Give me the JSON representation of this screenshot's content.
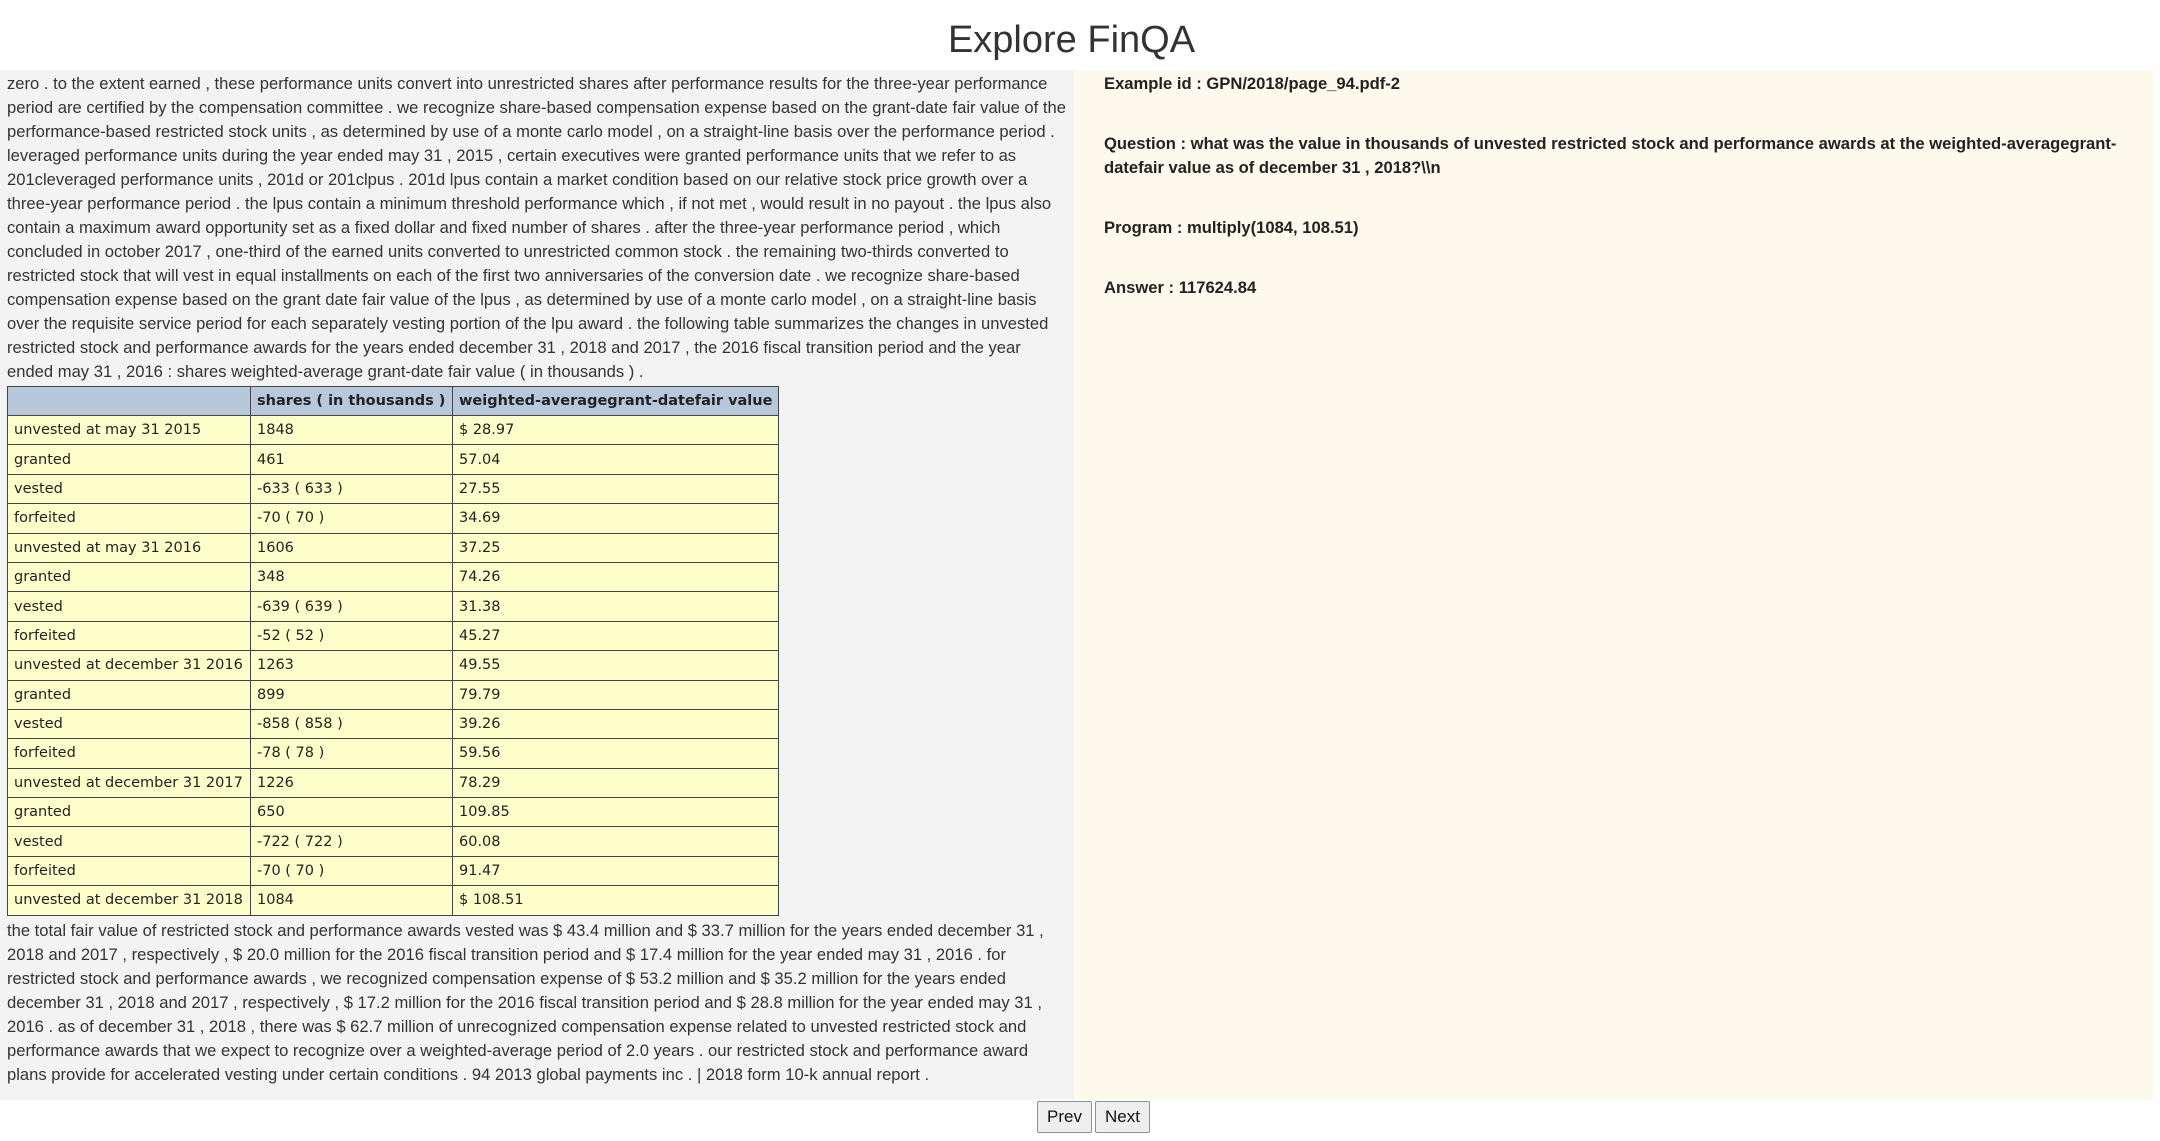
{
  "page": {
    "title": "Explore FinQA"
  },
  "context": {
    "pre_text": "zero . to the extent earned , these performance units convert into unrestricted shares after performance results for the three-year performance period are certified by the compensation committee . we recognize share-based compensation expense based on the grant-date fair value of the performance-based restricted stock units , as determined by use of a monte carlo model , on a straight-line basis over the performance period . leveraged performance units during the year ended may 31 , 2015 , certain executives were granted performance units that we refer to as 201cleveraged performance units , 201d or 201clpus . 201d lpus contain a market condition based on our relative stock price growth over a three-year performance period . the lpus contain a minimum threshold performance which , if not met , would result in no payout . the lpus also contain a maximum award opportunity set as a fixed dollar and fixed number of shares . after the three-year performance period , which concluded in october 2017 , one-third of the earned units converted to unrestricted common stock . the remaining two-thirds converted to restricted stock that will vest in equal installments on each of the first two anniversaries of the conversion date . we recognize share-based compensation expense based on the grant date fair value of the lpus , as determined by use of a monte carlo model , on a straight-line basis over the requisite service period for each separately vesting portion of the lpu award . the following table summarizes the changes in unvested restricted stock and performance awards for the years ended december 31 , 2018 and 2017 , the 2016 fiscal transition period and the year ended may 31 , 2016 : shares weighted-average grant-date fair value ( in thousands ) .",
    "post_text": "the total fair value of restricted stock and performance awards vested was $ 43.4 million and $ 33.7 million for the years ended december 31 , 2018 and 2017 , respectively , $ 20.0 million for the 2016 fiscal transition period and $ 17.4 million for the year ended may 31 , 2016 . for restricted stock and performance awards , we recognized compensation expense of $ 53.2 million and $ 35.2 million for the years ended december 31 , 2018 and 2017 , respectively , $ 17.2 million for the 2016 fiscal transition period and $ 28.8 million for the year ended may 31 , 2016 . as of december 31 , 2018 , there was $ 62.7 million of unrecognized compensation expense related to unvested restricted stock and performance awards that we expect to recognize over a weighted-average period of 2.0 years . our restricted stock and performance award plans provide for accelerated vesting under certain conditions . 94 2013 global payments inc . | 2018 form 10-k annual report ."
  },
  "table": {
    "headers": [
      "",
      "shares ( in thousands )",
      "weighted-averagegrant-datefair value"
    ],
    "rows": [
      [
        "unvested at may 31 2015",
        "1848",
        "$ 28.97"
      ],
      [
        "granted",
        "461",
        "57.04"
      ],
      [
        "vested",
        "-633 ( 633 )",
        "27.55"
      ],
      [
        "forfeited",
        "-70 ( 70 )",
        "34.69"
      ],
      [
        "unvested at may 31 2016",
        "1606",
        "37.25"
      ],
      [
        "granted",
        "348",
        "74.26"
      ],
      [
        "vested",
        "-639 ( 639 )",
        "31.38"
      ],
      [
        "forfeited",
        "-52 ( 52 )",
        "45.27"
      ],
      [
        "unvested at december 31 2016",
        "1263",
        "49.55"
      ],
      [
        "granted",
        "899",
        "79.79"
      ],
      [
        "vested",
        "-858 ( 858 )",
        "39.26"
      ],
      [
        "forfeited",
        "-78 ( 78 )",
        "59.56"
      ],
      [
        "unvested at december 31 2017",
        "1226",
        "78.29"
      ],
      [
        "granted",
        "650",
        "109.85"
      ],
      [
        "vested",
        "-722 ( 722 )",
        "60.08"
      ],
      [
        "forfeited",
        "-70 ( 70 )",
        "91.47"
      ],
      [
        "unvested at december 31 2018",
        "1084",
        "$ 108.51"
      ]
    ]
  },
  "details": {
    "example_id": "Example id : GPN/2018/page_94.pdf-2",
    "question": "Question : what was the value in thousands of unvested restricted stock and performance awards at the weighted-averagegrant-datefair value as of december 31 , 2018?\\\\n",
    "program": "Program : multiply(1084, 108.51)",
    "answer": "Answer : 117624.84"
  },
  "nav": {
    "prev_label": "Prev",
    "next_label": "Next"
  }
}
